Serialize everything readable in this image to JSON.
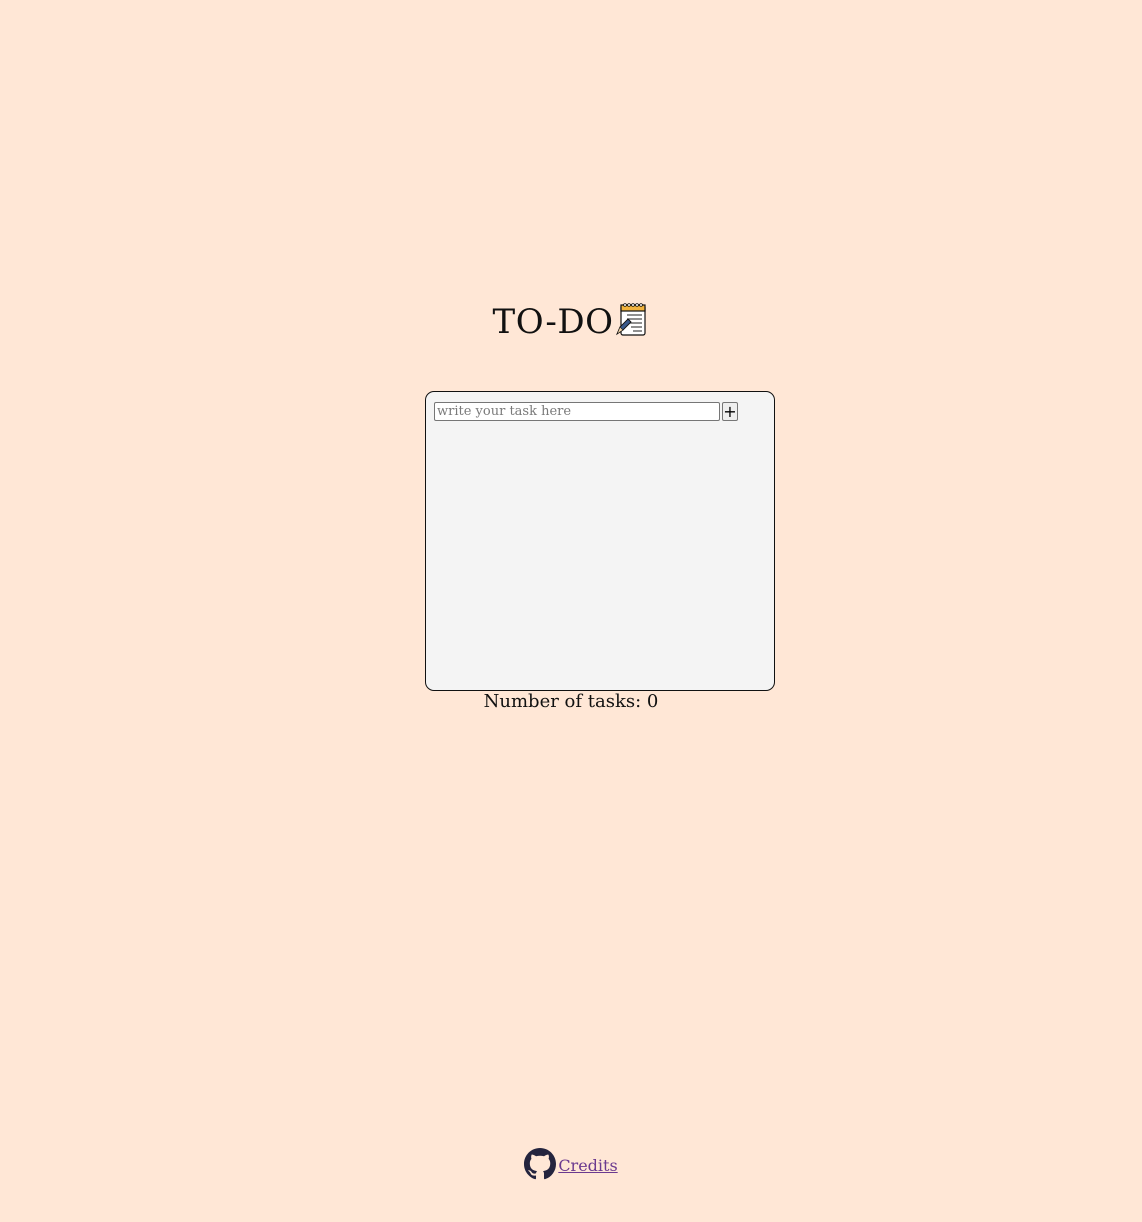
{
  "header": {
    "title": "TO-DO",
    "icon": "notepad-icon"
  },
  "task_panel": {
    "input_placeholder": "write your task here",
    "input_value": "",
    "add_label": "+",
    "tasks": []
  },
  "counter": {
    "text": "Number of tasks: 0"
  },
  "footer": {
    "icon": "github-icon",
    "credits_label": "Credits"
  },
  "colors": {
    "page_background": "#ffe7d6",
    "panel_background": "#f4f4f4",
    "link": "#6b3a8f",
    "github_icon": "#24243e"
  }
}
